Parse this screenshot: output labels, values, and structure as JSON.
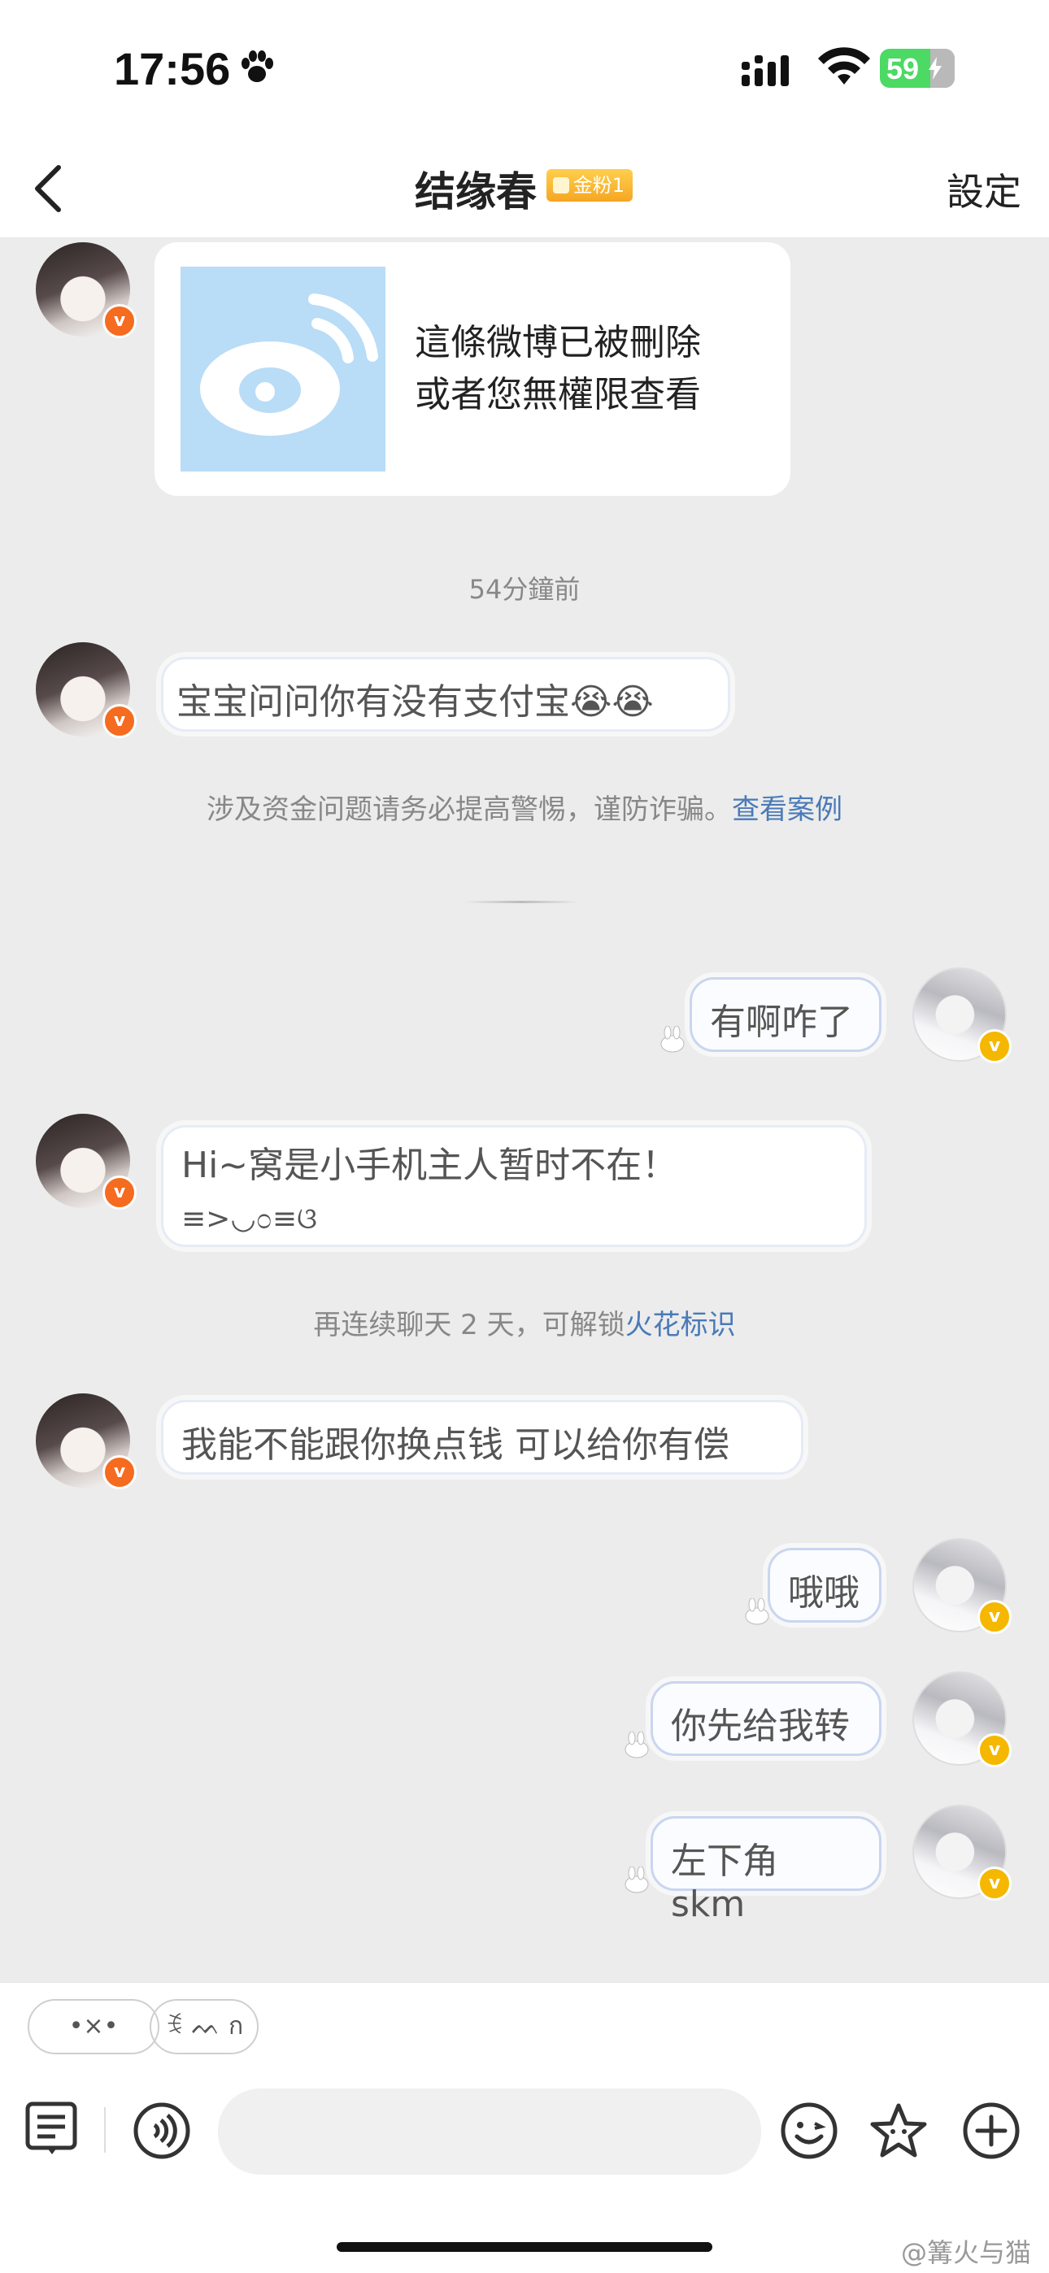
{
  "status_bar": {
    "time": "17:56",
    "battery": "59"
  },
  "header": {
    "title": "结缘春",
    "fan_badge": "金粉1",
    "settings": "設定"
  },
  "shared_post": {
    "line1": "這條微博已被刪除",
    "line2": "或者您無權限查看"
  },
  "timestamp": "54分鐘前",
  "messages": [
    {
      "side": "left",
      "text": "宝宝问问你有没有支付宝😭😭"
    },
    {
      "side": "right",
      "text": "有啊咋了"
    },
    {
      "side": "left",
      "text": "Hi~窝是小手机主人暂时不在！",
      "subtext": "≡>◡೦≡ଓ"
    },
    {
      "side": "left",
      "text": "我能不能跟你换点钱 可以给你有偿"
    },
    {
      "side": "right",
      "text": "哦哦"
    },
    {
      "side": "right",
      "text": "你先给我转"
    },
    {
      "side": "right",
      "text": "左下角 skm"
    }
  ],
  "fraud_notice": {
    "text": "涉及资金问题请务必提高警惕，谨防诈骗。",
    "link": "查看案例"
  },
  "streak_notice": {
    "text": "再连续聊天 2 天，可解锁",
    "link": "火花标识"
  },
  "quick_replies": [
    "•×•",
    "ꉂ ᨓ ก"
  ],
  "input": {
    "placeholder": ""
  },
  "watermark": "@篝火与猫",
  "colors": {
    "accent_link": "#4a7ab8",
    "verified_orange": "#f56b1f",
    "verified_gold": "#f5b700",
    "background": "#ececec"
  },
  "icons": [
    "paw-icon",
    "signal-icon",
    "wifi-icon",
    "battery-icon",
    "back-arrow-icon",
    "weibo-logo",
    "verified-badge",
    "list-icon",
    "voice-icon",
    "emoji-icon",
    "star-icon",
    "plus-icon"
  ]
}
